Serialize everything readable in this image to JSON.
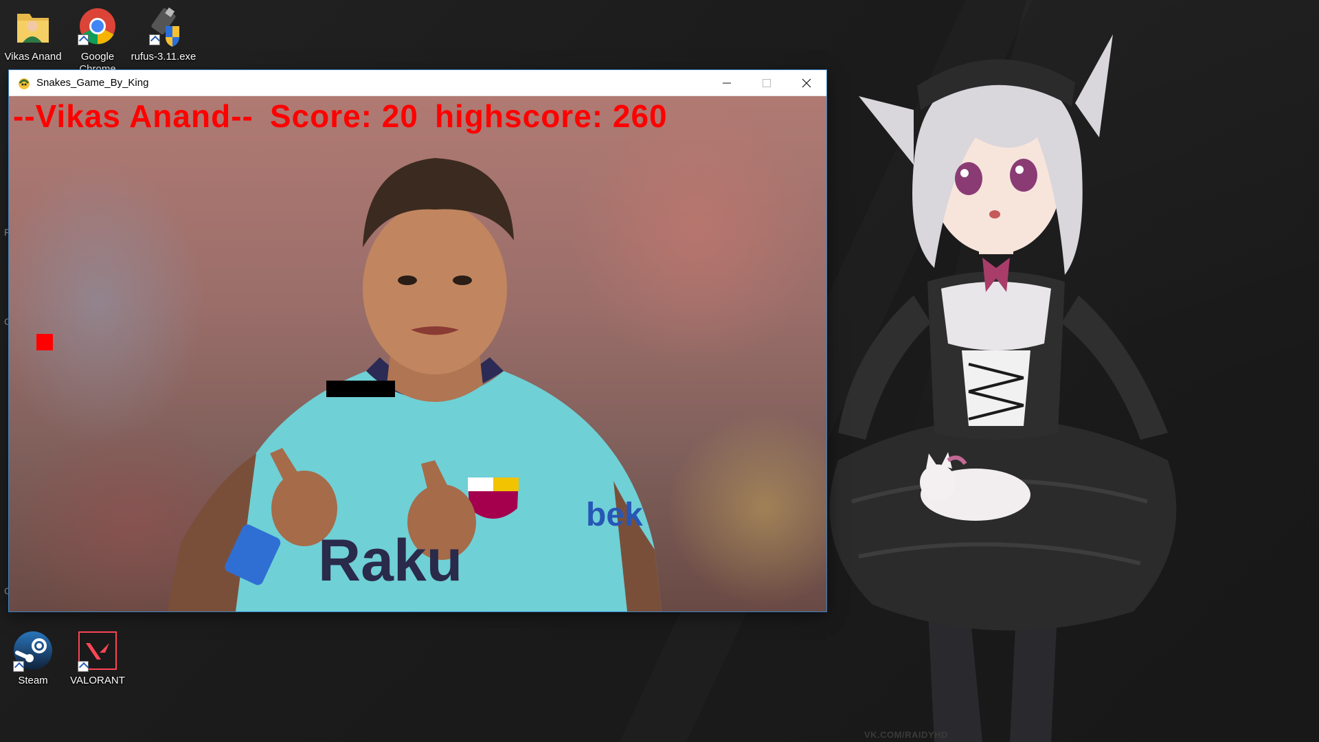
{
  "desktop": {
    "icons_top": [
      {
        "label": "Vikas Anand",
        "icon": "user-folder-icon"
      },
      {
        "label": "Google Chrome",
        "icon": "chrome-icon"
      },
      {
        "label": "rufus-3.11.exe",
        "icon": "rufus-icon"
      }
    ],
    "icons_bottom": [
      {
        "label": "Steam",
        "icon": "steam-icon"
      },
      {
        "label": "VALORANT",
        "icon": "valorant-icon"
      }
    ],
    "wallpaper_credit": "VK.COM/RAIDYHD",
    "left_edge_letters": [
      "F",
      "C",
      "C"
    ]
  },
  "window": {
    "title": "Snakes_Game_By_King",
    "icon": "pygame-snake-icon",
    "controls": [
      "minimize-icon",
      "maximize-icon",
      "close-icon"
    ]
  },
  "game": {
    "player_label": "--Vikas Anand--",
    "score_label": "Score: 20",
    "highscore_label": "highscore: 260",
    "colors": {
      "hud": "#ff0000",
      "food": "#ff0000",
      "snake": "#000000"
    }
  }
}
